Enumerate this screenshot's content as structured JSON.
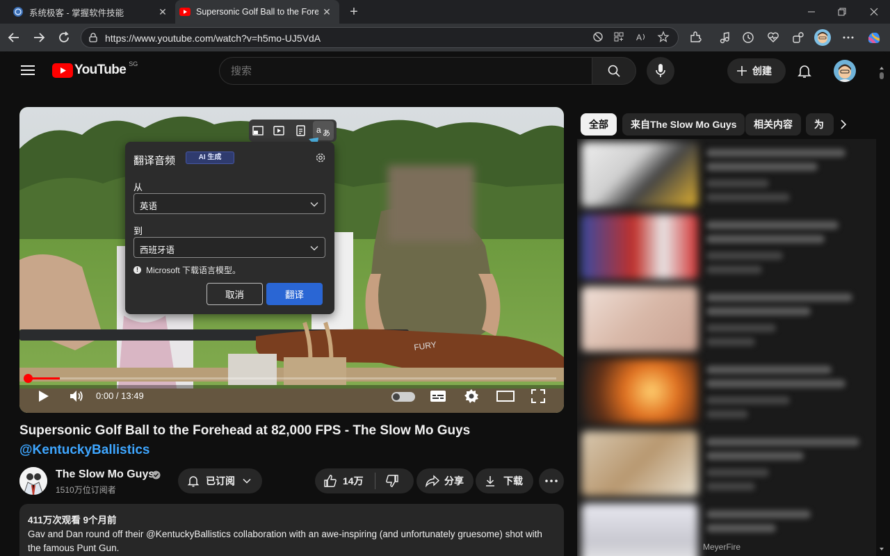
{
  "browser": {
    "tabs": [
      {
        "title": "系统极客 - 掌握软件技能",
        "icon": "globe-icon"
      },
      {
        "title": "Supersonic Golf Ball to the Forehead",
        "icon": "youtube-icon",
        "active": true
      }
    ],
    "url": "https://www.youtube.com/watch?v=h5mo-UJ5VdA"
  },
  "youtube": {
    "logo_text": "YouTube",
    "region": "SG",
    "search_placeholder": "搜索",
    "create_label": "创建"
  },
  "player": {
    "time": "0:00 / 13:49",
    "progress_fraction": 0.06
  },
  "translator": {
    "title": "翻译音频",
    "badge": "AI 生成",
    "from_label": "从",
    "from_value": "英语",
    "to_label": "到",
    "to_value": "西班牙语",
    "note": "Microsoft 下载语言模型。",
    "cancel_label": "取消",
    "ok_label": "翻译"
  },
  "video": {
    "title": "Supersonic Golf Ball to the Forehead at 82,000 FPS - The Slow Mo Guys",
    "mention": "@KentuckyBallistics",
    "channel": "The Slow Mo Guys",
    "subscribers": "1510万位订阅者",
    "subscribed_label": "已订阅",
    "likes": "14万",
    "share_label": "分享",
    "download_label": "下载",
    "views_meta": "411万次观看  9个月前",
    "description": "Gav and Dan round off their  @KentuckyBallistics  collaboration with an awe-inspiring (and unfortunately gruesome) shot with the famous Punt Gun."
  },
  "sidebar": {
    "chips": [
      "全部",
      "来自The Slow Mo Guys",
      "相关内容",
      "为"
    ],
    "last_channel": "MeyerFire"
  }
}
